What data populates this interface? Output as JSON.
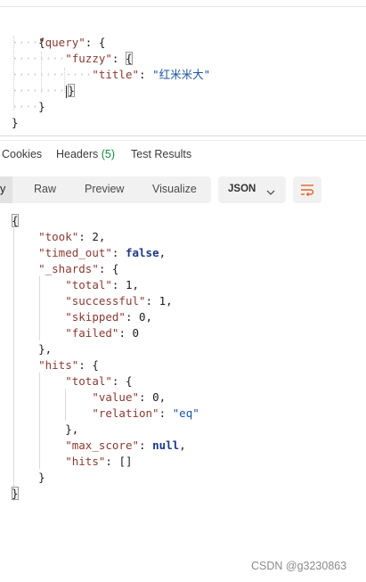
{
  "request_body": {
    "open_brace": "{",
    "query_key": "\"query\"",
    "fuzzy_key": "\"fuzzy\"",
    "title_key": "\"title\"",
    "title_value": "\"红米米大\"",
    "colon": ": ",
    "open": "{",
    "close": "}"
  },
  "tabs": {
    "cookies": "Cookies",
    "headers": "Headers",
    "headers_count": "(5)",
    "test_results": "Test Results"
  },
  "format_bar": {
    "pretty_fragment": "y",
    "raw": "Raw",
    "preview": "Preview",
    "visualize": "Visualize",
    "json": "JSON"
  },
  "response": {
    "open": "{",
    "close": "}",
    "took_key": "\"took\"",
    "took_val": "2",
    "timed_out_key": "\"timed_out\"",
    "timed_out_val": "false",
    "shards_key": "\"_shards\"",
    "shards_total_key": "\"total\"",
    "shards_total_val": "1",
    "successful_key": "\"successful\"",
    "successful_val": "1",
    "skipped_key": "\"skipped\"",
    "skipped_val": "0",
    "failed_key": "\"failed\"",
    "failed_val": "0",
    "hits_key": "\"hits\"",
    "hits_total_key": "\"total\"",
    "value_key": "\"value\"",
    "value_val": "0",
    "relation_key": "\"relation\"",
    "relation_val": "\"eq\"",
    "max_score_key": "\"max_score\"",
    "max_score_val": "null",
    "inner_hits_key": "\"hits\"",
    "inner_hits_val": "[]",
    "close_comma": "},"
  },
  "watermark": "CSDN @g3230863",
  "colors": {
    "key": "#8a3a32",
    "string": "#1a54a0",
    "literal": "#1b3a88",
    "count_green": "#1c8a3c",
    "wrap_icon": "#e0652a"
  },
  "icons": {
    "json_dropdown": "chevron-down-icon",
    "wrap": "wrap-lines-icon"
  }
}
